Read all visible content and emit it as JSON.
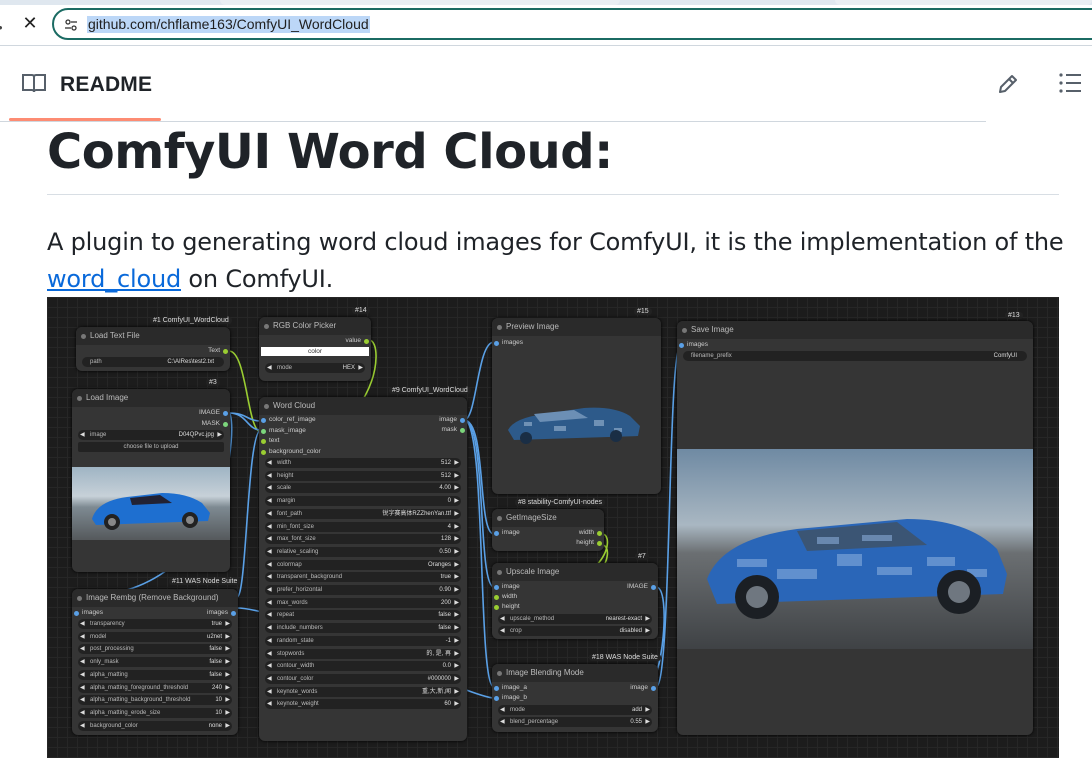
{
  "browser": {
    "url": "github.com/chflame163/ComfyUI_WordCloud",
    "close_glyph": "✕"
  },
  "readme": {
    "title": "README"
  },
  "article": {
    "heading": "ComfyUI Word Cloud:",
    "para_pre": "A plugin to generating word cloud images for ComfyUI, it is the implementation of the ",
    "link": "word_cloud",
    "para_post": " on ComfyUI."
  },
  "graph": {
    "load_text": {
      "badge": "#1 ComfyUI_WordCloud",
      "title": "Load Text File",
      "out": "Text",
      "path_label": "path",
      "path_value": "C:\\AIRes\\test2.txt"
    },
    "load_image": {
      "badge": "#3",
      "title": "Load Image",
      "out1": "IMAGE",
      "out2": "MASK",
      "image_label": "image",
      "image_value": "D04QPvc.jpg",
      "upload": "choose file to upload"
    },
    "rgb": {
      "badge": "#14",
      "title": "RGB Color Picker",
      "out": "value",
      "color": "color",
      "mode_label": "mode",
      "mode_value": "HEX"
    },
    "wordcloud": {
      "badge": "#9 ComfyUI_WordCloud",
      "title": "Word Cloud",
      "inputs": [
        "color_ref_image",
        "mask_image",
        "text",
        "background_color"
      ],
      "outputs": [
        "image",
        "mask"
      ],
      "widgets": [
        {
          "label": "width",
          "value": "512"
        },
        {
          "label": "height",
          "value": "512"
        },
        {
          "label": "scale",
          "value": "4.00"
        },
        {
          "label": "margin",
          "value": "0"
        },
        {
          "label": "font_path",
          "value": "锐字赛高体RZZhenYan.ttf"
        },
        {
          "label": "min_font_size",
          "value": "4"
        },
        {
          "label": "max_font_size",
          "value": "128"
        },
        {
          "label": "relative_scaling",
          "value": "0.50"
        },
        {
          "label": "colormap",
          "value": "Oranges"
        },
        {
          "label": "transparent_background",
          "value": "true"
        },
        {
          "label": "prefer_horizontal",
          "value": "0.90"
        },
        {
          "label": "max_words",
          "value": "200"
        },
        {
          "label": "repeat",
          "value": "false"
        },
        {
          "label": "include_numbers",
          "value": "false"
        },
        {
          "label": "random_state",
          "value": "-1"
        },
        {
          "label": "stopwords",
          "value": "的, 是, 再"
        },
        {
          "label": "contour_width",
          "value": "0.0"
        },
        {
          "label": "contour_color",
          "value": "#000000"
        },
        {
          "label": "keynote_words",
          "value": "重,大,新,闻"
        },
        {
          "label": "keynote_weight",
          "value": "60"
        }
      ]
    },
    "rembg": {
      "badge": "#11 WAS Node Suite",
      "title": "Image Rembg (Remove Background)",
      "in": "images",
      "out": "images",
      "widgets": [
        {
          "label": "transparency",
          "value": "true"
        },
        {
          "label": "model",
          "value": "u2net"
        },
        {
          "label": "post_processing",
          "value": "false"
        },
        {
          "label": "only_mask",
          "value": "false"
        },
        {
          "label": "alpha_matting",
          "value": "false"
        },
        {
          "label": "alpha_matting_foreground_threshold",
          "value": "240"
        },
        {
          "label": "alpha_matting_background_threshold",
          "value": "10"
        },
        {
          "label": "alpha_matting_erode_size",
          "value": "10"
        },
        {
          "label": "background_color",
          "value": "none"
        }
      ]
    },
    "preview": {
      "badge": "#15",
      "title": "Preview Image",
      "in": "images"
    },
    "getsize": {
      "badge": "#8 stability-ComfyUI-nodes",
      "title": "GetImageSize",
      "in": "image",
      "out1": "width",
      "out2": "height"
    },
    "upscale": {
      "badge": "#7",
      "title": "Upscale Image",
      "inputs": [
        "image",
        "width",
        "height"
      ],
      "out": "IMAGE",
      "widgets": [
        {
          "label": "upscale_method",
          "value": "nearest-exact"
        },
        {
          "label": "crop",
          "value": "disabled"
        }
      ]
    },
    "blend": {
      "badge": "#18 WAS Node Suite",
      "title": "Image Blending Mode",
      "inputs": [
        "image_a",
        "image_b"
      ],
      "out": "image",
      "widgets": [
        {
          "label": "mode",
          "value": "add"
        },
        {
          "label": "blend_percentage",
          "value": "0.55"
        }
      ]
    },
    "save": {
      "badge": "#13",
      "title": "Save Image",
      "in": "images",
      "prefix_label": "filename_prefix",
      "prefix_value": "ComfyUI"
    }
  },
  "colors": {
    "accent": "#fd8c73",
    "link": "#0969da",
    "text": "#1f2328",
    "url_border": "#1b6b63"
  }
}
